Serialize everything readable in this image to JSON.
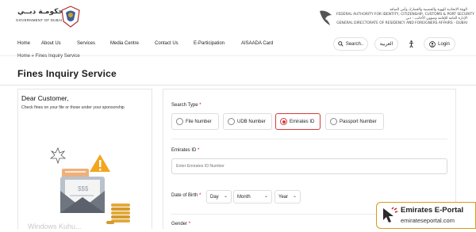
{
  "header": {
    "gov_logo_ar": "حكومـة دبــي",
    "gov_logo_en": "GOVERNMENT OF DUBAI",
    "gdrfa_lines": [
      "الهيئة الاتحادية للهوية والجنسية والجمارك وأمن المنافذ",
      "FEDERAL AUTHORITY FOR IDENTITY, CITIZENSHIP, CUSTOMS & PORT SECURITY",
      "الإدارة العامة للإقامة وشؤون الأجانب - دبي",
      "GENERAL DIRECTORATE OF RESIDENCY AND FOREIGNERS AFFAIRS - DUBAI"
    ]
  },
  "nav": {
    "items": [
      "Home",
      "About Us",
      "Services",
      "Media Centre",
      "Contact Us",
      "E-Participation",
      "AISAADA Card"
    ],
    "search_label": "Search..",
    "arabic_label": "العربية",
    "login_label": "Login"
  },
  "breadcrumb": "Home » Fines Inquiry Service",
  "page_title": "Fines Inquiry Service",
  "left_panel": {
    "greeting": "Dear Customer,",
    "description": "Check fines on your file or those under your sponsorship",
    "watermark": "Windows Kuhu..."
  },
  "form": {
    "search_type_label": "Search Type",
    "search_types": [
      "File Number",
      "UDB Number",
      "Emirates ID",
      "Passport Number"
    ],
    "selected_type": "Emirates ID",
    "emirates_id_label": "Emirates ID",
    "emirates_id_placeholder": "Enter Emirates ID Number",
    "dob_label": "Date of Birth",
    "day_label": "Day",
    "month_label": "Month",
    "year_label": "Year",
    "gender_label": "Gender",
    "required_mark": "*"
  },
  "badge": {
    "title": "Emirates E-Portal",
    "url": "emirateseportal.com"
  },
  "colors": {
    "accent_red": "#d53c3c",
    "badge_border": "#d89a1a"
  }
}
